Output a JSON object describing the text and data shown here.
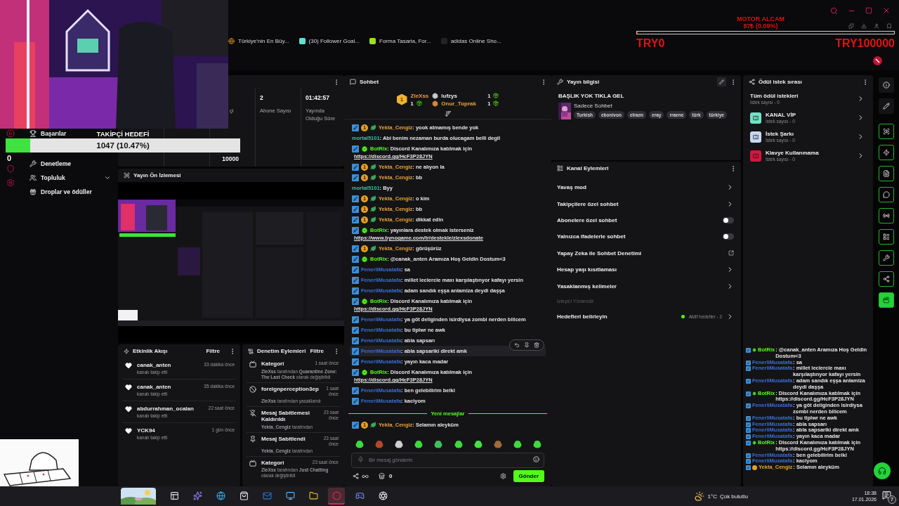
{
  "browser": {
    "bookmarks": [
      {
        "kind": "globe",
        "label": "Türkiye'nin En Büy..."
      },
      {
        "kind": "tile",
        "label": "(30) Follower Goal..."
      },
      {
        "kind": "badge",
        "label": "Forma Tasarla, For..."
      },
      {
        "kind": "plain",
        "label": "adidas Online Sho..."
      }
    ]
  },
  "donation_goal": {
    "title": "MOTOR ALCAM",
    "amount": "87₺ (0.09%)",
    "level": 0.0009,
    "min": "TRY0",
    "max": "TRY100000"
  },
  "follower_goal": {
    "title": "TAKİPÇİ HEDEFİ",
    "progress": "1047 (10.47%)",
    "level": 0.1047,
    "min": "0",
    "max": "10000"
  },
  "nav": [
    {
      "label": "Başarılar"
    },
    {
      "label": "Denetleme"
    },
    {
      "label": "Topluluk",
      "expanded": false
    },
    {
      "label": "Droplar ve ödüller"
    }
  ],
  "stats": [
    {
      "label": "çi"
    },
    {
      "value": "2",
      "label": "Abone Sayısı"
    },
    {
      "value": "01:42:57",
      "label": "Yayında Olduğu Süre"
    }
  ],
  "preview": {
    "title": "Yayın Ön İzlemesi"
  },
  "activity": {
    "title": "Etkinlik Akışı",
    "filter": "Filtre",
    "items": [
      {
        "user": "canak_anten",
        "action": "kanalı takip etti",
        "time": "33 dakika önce"
      },
      {
        "user": "canak_anten",
        "action": "kanalı takip etti",
        "time": "35 dakika önce"
      },
      {
        "user": "abdurrahman_ocalan",
        "action": "kanalı takip etti",
        "time": "22 saat önce"
      },
      {
        "user": "YCK94",
        "action": "kanalı takip etti",
        "time": "1 gün önce"
      }
    ]
  },
  "moderation": {
    "title": "Denetim Eylemleri",
    "filter": "Filtre",
    "items": [
      {
        "kind": "category",
        "title": "Kategori",
        "time": "1 saat önce",
        "detail": "**ZleXss** tarafından **Quarantine Zone: The Last Check** olarak değiştirildi"
      },
      {
        "kind": "ban",
        "title": "foreignperception3ep",
        "time": "1 saat önce",
        "detail": "**ZleXss** tarafından yasaklandı"
      },
      {
        "kind": "unpin",
        "title": "Mesaj Sabitlemesi Kaldırıldı",
        "time": "23 saat önce",
        "detail": "**Yekta_Cengiz** tarafından"
      },
      {
        "kind": "pin",
        "title": "Mesaj Sabitlendi",
        "time": "23 saat önce",
        "detail": "**Yekta_Cengiz** tarafından"
      },
      {
        "kind": "category",
        "title": "Kategori",
        "time": "23 saat önce",
        "detail": "**ZleXss** tarafından **Just Chatting** olarak değiştirildi"
      }
    ]
  },
  "chat": {
    "title": "Sohbet",
    "leaders": [
      {
        "kind": "gold",
        "rank": "1",
        "name": "ZleXss",
        "count": "1",
        "color": "#e8a33a"
      },
      {
        "kind": "silver",
        "name": "lufzys",
        "count": "1",
        "color": "#efeff1"
      },
      {
        "kind": "bronze",
        "name": "Onur_Toprak",
        "count": "1",
        "color": "#e8a33a"
      }
    ],
    "messages": [
      {
        "badges": [
          {
            "kind": "mod"
          },
          {
            "kind": "sub",
            "text": "1"
          },
          {
            "kind": "leaf"
          }
        ],
        "user": "Yekta_Cengiz",
        "color": "#e8a33a",
        "text": ": yook atmamış bende yok",
        "hovered": false
      },
      {
        "user": "mortal5101",
        "color": "#2fc4a2",
        "text": ": Abi benim nezaman burda olucagam belli degil",
        "hovered": false
      },
      {
        "badges": [
          {
            "kind": "mod"
          },
          {
            "kind": "verified"
          }
        ],
        "user": "BotRix",
        "color": "#53fc18",
        "text": ": Discord Kanalımıza katılmak için",
        "link": "https://discord.gg/HcF3P28JYN",
        "hovered": false
      },
      {
        "badges": [
          {
            "kind": "mod"
          },
          {
            "kind": "sub",
            "text": "1"
          },
          {
            "kind": "leaf"
          }
        ],
        "user": "Yekta_Cengiz",
        "color": "#e8a33a",
        "text": ": ne alıyon la",
        "hovered": false
      },
      {
        "badges": [
          {
            "kind": "mod"
          },
          {
            "kind": "sub",
            "text": "1"
          },
          {
            "kind": "leaf"
          }
        ],
        "user": "Yekta_Cengiz",
        "color": "#e8a33a",
        "text": ": bb",
        "hovered": false
      },
      {
        "user": "mortal5101",
        "color": "#2fc4a2",
        "text": ": Byy",
        "hovered": false
      },
      {
        "badges": [
          {
            "kind": "mod"
          },
          {
            "kind": "sub",
            "text": "1"
          },
          {
            "kind": "leaf"
          }
        ],
        "user": "Yekta_Cengiz",
        "color": "#e8a33a",
        "text": ": o kim",
        "hovered": false
      },
      {
        "badges": [
          {
            "kind": "mod"
          },
          {
            "kind": "sub",
            "text": "1"
          },
          {
            "kind": "leaf"
          }
        ],
        "user": "Yekta_Cengiz",
        "color": "#e8a33a",
        "text": ": bb",
        "hovered": false
      },
      {
        "badges": [
          {
            "kind": "mod"
          },
          {
            "kind": "sub",
            "text": "1"
          },
          {
            "kind": "leaf"
          }
        ],
        "user": "Yekta_Cengiz",
        "color": "#e8a33a",
        "text": ": dikkat edin",
        "hovered": false
      },
      {
        "badges": [
          {
            "kind": "mod"
          },
          {
            "kind": "verified"
          }
        ],
        "user": "BotRix",
        "color": "#53fc18",
        "text": ": yayınlara destek olmak isterseniz",
        "link": "https://www.bynogame.com/tr/destekle/zlexsdonate",
        "hovered": false
      },
      {
        "badges": [
          {
            "kind": "mod"
          },
          {
            "kind": "sub",
            "text": "1"
          },
          {
            "kind": "leaf"
          }
        ],
        "user": "Yekta_Cengiz",
        "color": "#e8a33a",
        "text": ": görüşürüz",
        "hovered": false
      },
      {
        "badges": [
          {
            "kind": "mod"
          },
          {
            "kind": "verified"
          }
        ],
        "user": "BotRix",
        "color": "#53fc18",
        "text": ": @canak_anten Aramıza Hoş Geldin Dostum<3",
        "hovered": false
      },
      {
        "badges": [
          {
            "kind": "mod"
          }
        ],
        "user": "FenerliMusatafa",
        "color": "#3b6fd8",
        "text": ": sa",
        "hovered": false
      },
      {
        "badges": [
          {
            "kind": "mod"
          }
        ],
        "user": "FenerliMusatafa",
        "color": "#3b6fd8",
        "text": ": millet leclercle maxı karşılaştınyor kafayı yersin",
        "hovered": false
      },
      {
        "badges": [
          {
            "kind": "mod"
          }
        ],
        "user": "FenerliMusatafa",
        "color": "#3b6fd8",
        "text": ": adam sandık eşşa anlamiza deydi daşşa",
        "hovered": false
      },
      {
        "badges": [
          {
            "kind": "mod"
          },
          {
            "kind": "verified"
          }
        ],
        "user": "BotRix",
        "color": "#53fc18",
        "text": ": Discord Kanalımıza katılmak için",
        "link": "https://discord.gg/HcF3P28JYN",
        "hovered": false
      },
      {
        "badges": [
          {
            "kind": "mod"
          }
        ],
        "user": "FenerliMusatafa",
        "color": "#3b6fd8",
        "text": ": ya göt deliginden isirdiysa zombi nerden bilicem",
        "hovered": false
      },
      {
        "badges": [
          {
            "kind": "mod"
          }
        ],
        "user": "FenerliMusatafa",
        "color": "#3b6fd8",
        "text": ": bu tiplwr ne awk",
        "hovered": false
      },
      {
        "badges": [
          {
            "kind": "mod"
          }
        ],
        "user": "FenerliMusatafa",
        "color": "#3b6fd8",
        "text": ": abla sapsarı",
        "hovered": false
      },
      {
        "badges": [
          {
            "kind": "mod"
          }
        ],
        "user": "FenerliMusatafa",
        "color": "#3b6fd8",
        "text": ": abla sapsariki direkt amk",
        "hovered": true
      },
      {
        "badges": [
          {
            "kind": "mod"
          }
        ],
        "user": "FenerliMusatafa",
        "color": "#3b6fd8",
        "text": ": yayın kaca madar",
        "hovered": false
      },
      {
        "badges": [
          {
            "kind": "mod"
          },
          {
            "kind": "verified"
          }
        ],
        "user": "BotRix",
        "color": "#53fc18",
        "text": ": Discord Kanalımıza katılmak için",
        "link": "https://discord.gg/HcF3P28JYN",
        "hovered": false
      },
      {
        "badges": [
          {
            "kind": "mod"
          }
        ],
        "user": "FenerliMusatafa",
        "color": "#3b6fd8",
        "text": ": ben gelebilirim belki",
        "hovered": false
      },
      {
        "badges": [
          {
            "kind": "mod"
          }
        ],
        "user": "FenerliMusatafa",
        "color": "#3b6fd8",
        "text": ": kaciyom",
        "hovered": false
      }
    ],
    "divider": "Yeni mesajlar",
    "new_messages": [
      {
        "badges": [
          {
            "kind": "mod"
          },
          {
            "kind": "sub",
            "text": "1"
          },
          {
            "kind": "leaf"
          }
        ],
        "user": "Yekta_Cengiz",
        "color": "#e8a33a",
        "text": ": Selamın aleyküm",
        "hovered": false
      }
    ],
    "input": {
      "placeholder": "Bir mesaj gönderin"
    },
    "points": "0",
    "send": "Gönder"
  },
  "stream_info": {
    "title": "Yayın bilgisi",
    "stream_title": "BAŞLIK YOK TIKLA GEL",
    "category": "Sadece Sohbet",
    "tags": [
      "Turkish",
      "ebonivon",
      "elraen",
      "eray",
      "rraene",
      "türk",
      "türkiye"
    ]
  },
  "channel_actions": {
    "title": "Kanal Eylemleri",
    "rows": [
      {
        "kind": "link",
        "label": "Yavaş mod"
      },
      {
        "kind": "link",
        "label": "Takipçilere özel sohbet"
      },
      {
        "kind": "toggle",
        "label": "Abonelere özel sohbet",
        "on": false
      },
      {
        "kind": "toggle",
        "label": "Yalnızca ifadelerle sohbet",
        "on": false
      },
      {
        "kind": "external",
        "label": "Yapay Zeka ile Sohbet Denetimi"
      },
      {
        "kind": "link",
        "label": "Hesap yaşı kısıtlaması"
      },
      {
        "kind": "link",
        "label": "Yasaklanmış kelimeler"
      },
      {
        "kind": "section",
        "label": "İzleyici Yönlendir"
      },
      {
        "kind": "goals",
        "label": "Hedefleri belirleyin",
        "status": "Aktif hedefler - 2"
      }
    ]
  },
  "rewards": {
    "title": "Ödül istek sırası",
    "all": {
      "label": "Tüm ödül istekleri",
      "count": "İstek sayısı - 0"
    },
    "items": [
      {
        "label": "KANAL VİP",
        "count": "İstek sayısı - 0",
        "color": "#6fe3c6"
      },
      {
        "label": "İstek Şarkı",
        "count": "İstek sayısı - 0",
        "color": "#c8d8f2"
      },
      {
        "label": "Klavye Kullanmama",
        "count": "İstek sayısı - 0",
        "color": "#d4163e"
      }
    ]
  },
  "rail": [
    {
      "kind": "plain",
      "selected": false
    },
    {
      "kind": "plain",
      "selected": false
    },
    {
      "kind": "tool",
      "selected": false
    },
    {
      "kind": "tool",
      "selected": false
    },
    {
      "kind": "tool",
      "selected": false
    },
    {
      "kind": "tool",
      "selected": false
    },
    {
      "kind": "tool",
      "selected": false
    },
    {
      "kind": "tool",
      "selected": false
    },
    {
      "kind": "tool",
      "selected": false
    },
    {
      "kind": "tool",
      "selected": false
    },
    {
      "kind": "tool",
      "selected": true
    }
  ],
  "taskbar": {
    "apps": [
      {
        "selected": false
      },
      {
        "selected": false
      },
      {
        "selected": false
      },
      {
        "selected": false
      },
      {
        "selected": false
      },
      {
        "selected": false
      },
      {
        "selected": false
      },
      {
        "selected": true
      },
      {
        "selected": false
      },
      {
        "selected": false
      }
    ],
    "weather": {
      "temp": "1°C",
      "text": "Çok bulutlu"
    },
    "time": "18:38",
    "date": "17.01.2026",
    "notifications": "7"
  },
  "overlay_chat": [
    {
      "badges": [
        {
          "kind": "mod"
        },
        {
          "kind": "verified"
        }
      ],
      "user": "BotRix",
      "color": "#53fc18",
      "text": ": @canak_anten Aramıza Hoş Geldin Dostum<3"
    },
    {
      "badges": [
        {
          "kind": "mod"
        }
      ],
      "user": "FenerliMusatafa",
      "color": "#3b6fd8",
      "text": ": sa"
    },
    {
      "badges": [
        {
          "kind": "mod"
        }
      ],
      "user": "FenerliMusatafa",
      "color": "#3b6fd8",
      "text": ": millet leclercle maxı karşılaştınyor kafayı yersin"
    },
    {
      "badges": [
        {
          "kind": "mod"
        }
      ],
      "user": "FenerliMusatafa",
      "color": "#3b6fd8",
      "text": ": adam sandık eşşa anlamiza deydi daşşa"
    },
    {
      "badges": [
        {
          "kind": "mod"
        },
        {
          "kind": "verified"
        }
      ],
      "user": "BotRix",
      "color": "#53fc18",
      "text": ": Discord Kanalımıza katılmak için https://discord.gg/HcF3P28JYN"
    },
    {
      "badges": [
        {
          "kind": "mod"
        }
      ],
      "user": "FenerliMusatafa",
      "color": "#3b6fd8",
      "text": ": ya göt deliginden isirdiysa zombi nerden bilicem"
    },
    {
      "badges": [
        {
          "kind": "mod"
        }
      ],
      "user": "FenerliMusatafa",
      "color": "#3b6fd8",
      "text": ": bu tiplwr ne awk"
    },
    {
      "badges": [
        {
          "kind": "mod"
        }
      ],
      "user": "FenerliMusatafa",
      "color": "#3b6fd8",
      "text": ": abla sapsarı"
    },
    {
      "badges": [
        {
          "kind": "mod"
        }
      ],
      "user": "FenerliMusatafa",
      "color": "#3b6fd8",
      "text": ": abla sapsariki direkt amk"
    },
    {
      "badges": [
        {
          "kind": "mod"
        }
      ],
      "user": "FenerliMusatafa",
      "color": "#3b6fd8",
      "text": ": yayın kaca madar"
    },
    {
      "badges": [
        {
          "kind": "mod"
        },
        {
          "kind": "verified"
        }
      ],
      "user": "BotRix",
      "color": "#53fc18",
      "text": ": Discord Kanalımıza katılmak için https://discord.gg/HcF3P28JYN"
    },
    {
      "badges": [
        {
          "kind": "mod"
        }
      ],
      "user": "FenerliMusatafa",
      "color": "#3b6fd8",
      "text": ": ben gelebilirim belki"
    },
    {
      "badges": [
        {
          "kind": "mod"
        }
      ],
      "user": "FenerliMusatafa",
      "color": "#3b6fd8",
      "text": ": kaciyom"
    },
    {
      "badges": [
        {
          "kind": "mod"
        },
        {
          "kind": "sub"
        }
      ],
      "user": "Yekta_Cengiz",
      "color": "#e8a33a",
      "text": ": Selamın aleyküm"
    }
  ]
}
